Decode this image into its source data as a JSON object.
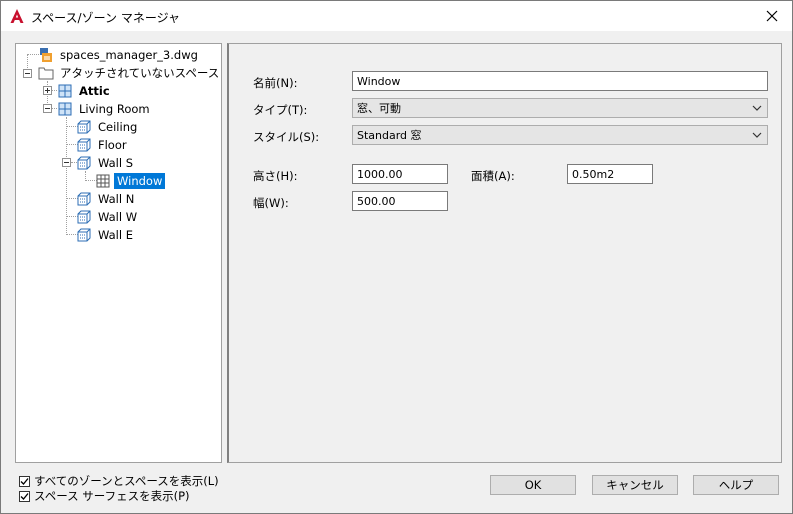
{
  "window": {
    "title": "スペース/ゾーン マネージャ"
  },
  "tree": {
    "root": "spaces_manager_3.dwg",
    "group": "アタッチされていないスペース",
    "attic": "Attic",
    "living_room": "Living Room",
    "ceiling": "Ceiling",
    "floor": "Floor",
    "wall_s": "Wall S",
    "window": "Window",
    "wall_n": "Wall N",
    "wall_w": "Wall W",
    "wall_e": "Wall E"
  },
  "form": {
    "name_label": "名前(N):",
    "name_value": "Window",
    "type_label": "タイプ(T):",
    "type_value": "窓、可動",
    "style_label": "スタイル(S):",
    "style_value": "Standard 窓",
    "height_label": "高さ(H):",
    "height_value": "1000.00",
    "area_label": "面積(A):",
    "area_value": "0.50m2",
    "width_label": "幅(W):",
    "width_value": "500.00"
  },
  "options": {
    "show_all": "すべてのゾーンとスペースを表示(L)",
    "show_surfaces": "スペース サーフェスを表示(P)"
  },
  "buttons": {
    "ok": "OK",
    "cancel": "キャンセル",
    "help": "ヘルプ"
  },
  "colors": {
    "selection": "#0078d7",
    "app_icon": "#c8102e"
  }
}
